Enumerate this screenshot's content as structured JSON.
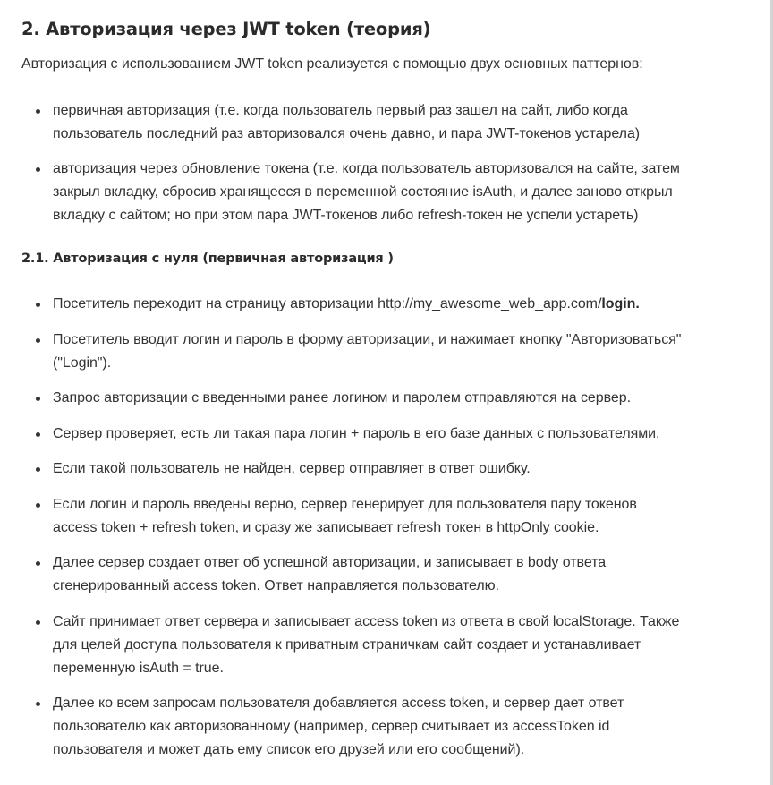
{
  "heading": "2. Авторизация через JWT token (теория)",
  "intro": "Авторизация с использованием JWT token реализуется с помощью двух основных паттернов:",
  "patterns": [
    {
      "lines": [
        "первичная авторизация (т.е. когда пользователь первый раз зашел на сайт, либо когда",
        "пользователь последний раз авторизовался очень давно, и пара JWT-токенов устарела)"
      ]
    },
    {
      "lines": [
        "авторизация через обновление токена (т.е. когда пользователь авторизовался на сайте, затем",
        "закрыл вкладку, сбросив хранящееся в переменной состояние isAuth, и далее заново открыл",
        "вкладку с сайтом; но при этом пара JWT-токенов либо refresh-токен не успели устареть)"
      ]
    }
  ],
  "subheading": "2.1. Авторизация с нуля (первичная авторизация )",
  "steps": [
    {
      "text": "Посетитель переходит на страницу авторизации http://my_awesome_web_app.com/",
      "bold": "login."
    },
    {
      "lines": [
        "Посетитель вводит логин и пароль в форму авторизации, и нажимает кнопку \"Авторизоваться\"",
        "(\"Login\")."
      ]
    },
    {
      "lines": [
        "Запрос авторизации с введенными ранее логином и паролем отправляются на сервер."
      ]
    },
    {
      "lines": [
        "Сервер проверяет, есть ли такая пара логин + пароль в его базе данных с пользователями."
      ]
    },
    {
      "lines": [
        "Если такой пользователь не найден, сервер отправляет в ответ ошибку."
      ]
    },
    {
      "lines": [
        "Если логин и пароль введены верно, сервер генерирует для пользователя пару токенов",
        "access token + refresh token, и сразу же записывает refresh токен в httpOnly cookie."
      ]
    },
    {
      "lines": [
        "Далее сервер создает ответ об успешной авторизации, и записывает в body ответа",
        "сгенерированный access token. Ответ направляется пользователю."
      ]
    },
    {
      "lines": [
        "Сайт принимает ответ сервера и записывает access token из ответа в свой localStorage. Также",
        "для целей доступа пользователя к приватным страничкам сайт создает и устанавливает",
        "переменную isAuth = true."
      ]
    },
    {
      "lines": [
        "Далее ко всем запросам пользователя добавляется access token, и сервер дает ответ",
        "пользователю как авторизованному (например, сервер считывает из accessToken id",
        "пользователя и может дать ему список его друзей или его сообщений)."
      ]
    }
  ]
}
